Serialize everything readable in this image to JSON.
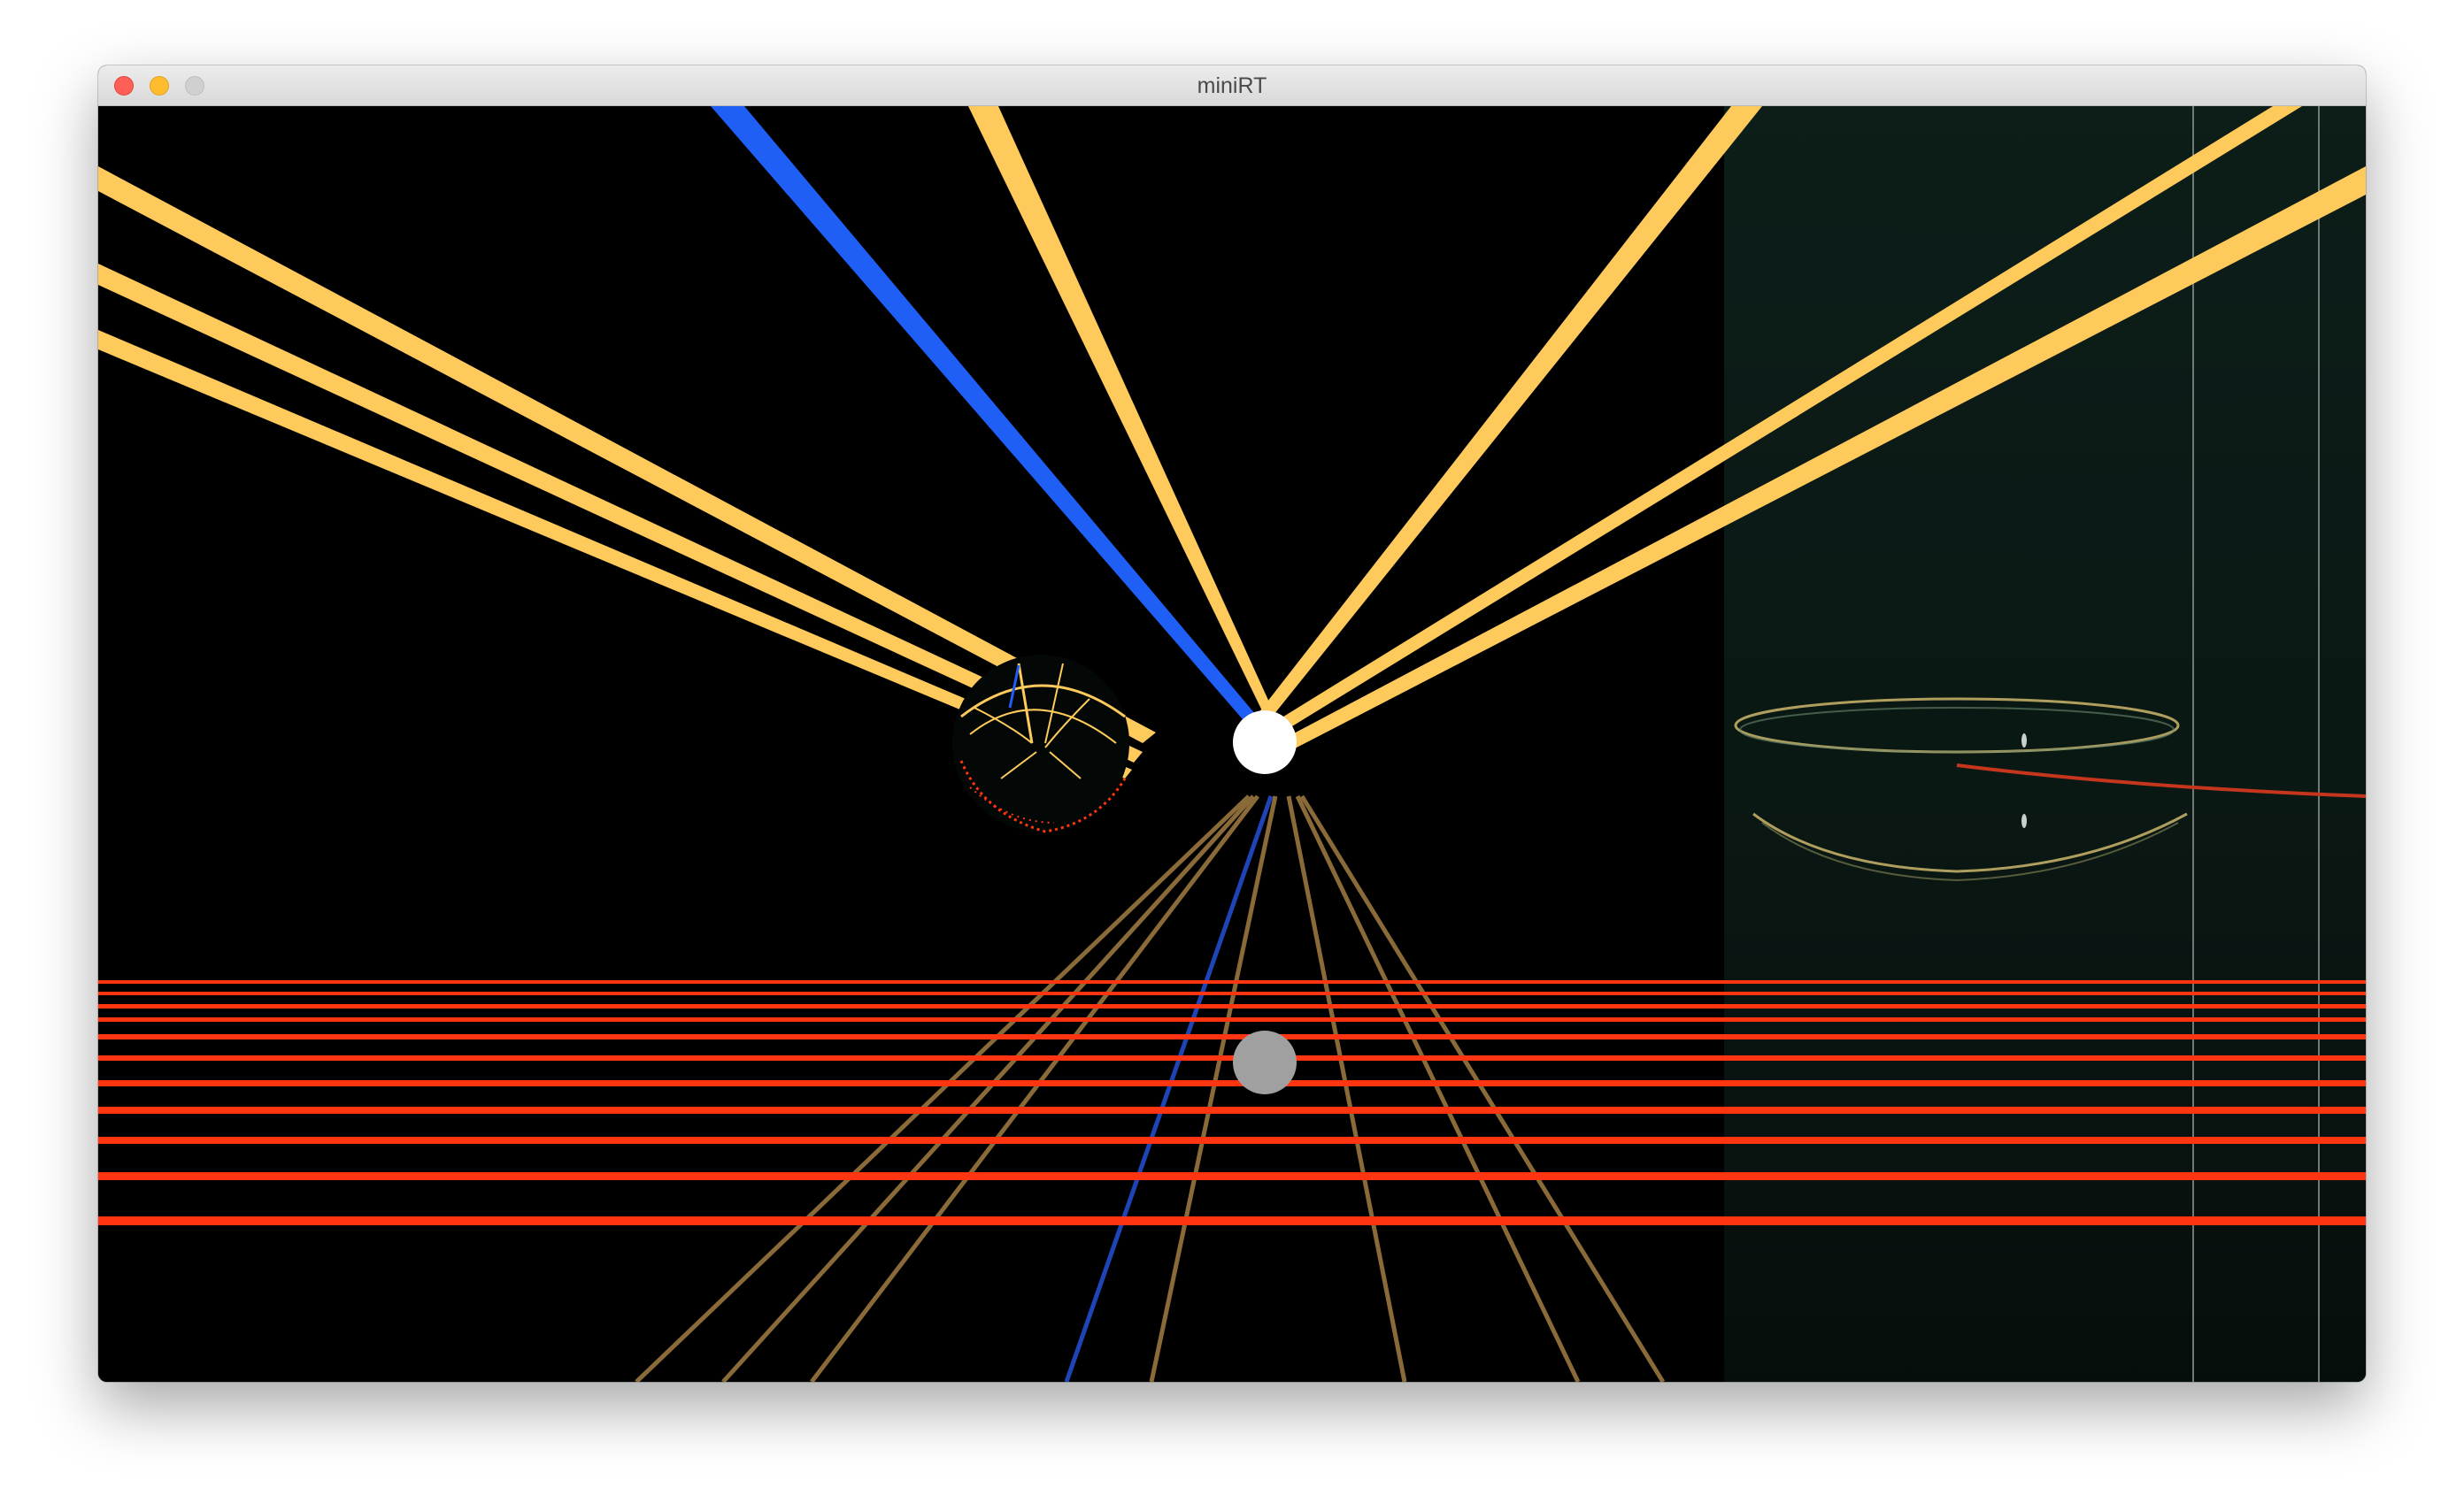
{
  "window": {
    "title": "miniRT",
    "controls": [
      "close",
      "minimize",
      "zoom"
    ]
  },
  "scene": {
    "background_color": "#000000",
    "ray_color": "#ffc95a",
    "blue_ray_color": "#1f5ff5",
    "floor_line_color": "#ff3410",
    "reflected_ray_color": "#8a6a38",
    "light_color": "#ffffff",
    "translucent_panel_color": "#0c1a16"
  }
}
